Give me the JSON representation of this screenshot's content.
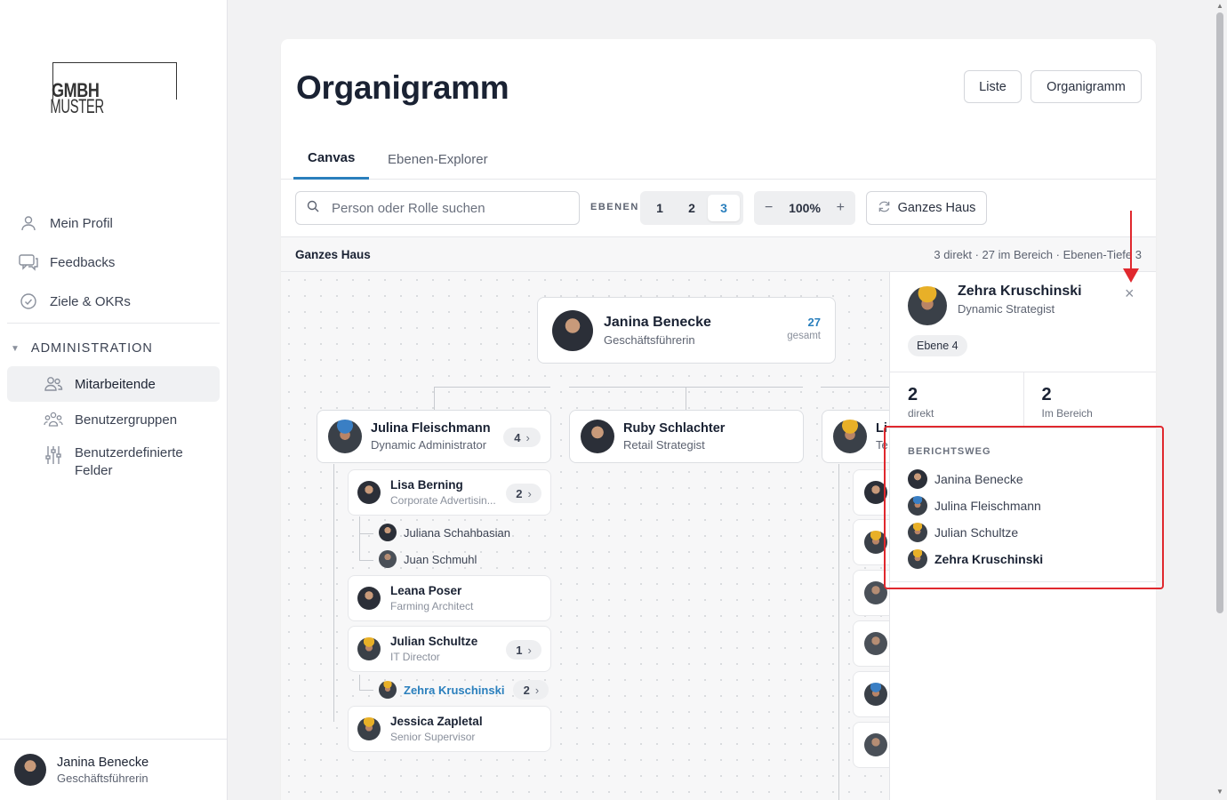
{
  "sidebar": {
    "logo": {
      "part1": "MUSTER",
      "part2": "GMBH"
    },
    "items": [
      {
        "label": "Mein Profil",
        "icon": "user-icon"
      },
      {
        "label": "Feedbacks",
        "icon": "chat-icon"
      },
      {
        "label": "Ziele & OKRs",
        "icon": "check-circle-icon"
      }
    ],
    "admin": {
      "heading": "ADMINISTRATION",
      "items": [
        {
          "label": "Mitarbeitende",
          "icon": "users-icon",
          "active": true
        },
        {
          "label": "Benutzergruppen",
          "icon": "group-icon"
        },
        {
          "label": "Benutzerdefinierte Felder",
          "icon": "sliders-icon"
        }
      ]
    },
    "footer": {
      "name": "Janina Benecke",
      "role": "Geschäftsführerin"
    }
  },
  "page": {
    "title": "Organigramm",
    "view_buttons": [
      "Liste",
      "Organigramm"
    ],
    "tabs": [
      "Canvas",
      "Ebenen-Explorer"
    ],
    "active_tab": "Canvas"
  },
  "toolbar": {
    "search_placeholder": "Person oder Rolle suchen",
    "levels_label": "EBENEN",
    "levels": [
      "1",
      "2",
      "3"
    ],
    "active_level": "3",
    "zoom": "100%",
    "zoom_out": "−",
    "zoom_in": "+",
    "house_button": "Ganzes Haus"
  },
  "subbar": {
    "scope": "Ganzes Haus",
    "summary": "3 direkt · 27 im Bereich · Ebenen-Tiefe 3"
  },
  "org": {
    "root": {
      "name": "Janina Benecke",
      "role": "Geschäftsführerin",
      "count": "27",
      "count_label": "gesamt"
    },
    "level2": [
      {
        "name": "Julina Fleischmann",
        "role": "Dynamic Administrator",
        "count": "4"
      },
      {
        "name": "Ruby Schlachter",
        "role": "Retail Strategist"
      },
      {
        "name": "Li",
        "role": "Te"
      }
    ],
    "level3": [
      {
        "name": "Lisa Berning",
        "role": "Corporate Advertisin...",
        "count": "2"
      },
      {
        "name": "Leana Poser",
        "role": "Farming Architect"
      },
      {
        "name": "Julian Schultze",
        "role": "IT Director",
        "count": "1"
      },
      {
        "name": "Jessica Zapletal",
        "role": "Senior Supervisor"
      }
    ],
    "leaves_lisa": [
      "Juliana Schahbasian",
      "Juan Schmuhl"
    ],
    "leaf_julian": {
      "name": "Zehra Kruschinski",
      "count": "2"
    }
  },
  "detail": {
    "name": "Zehra Kruschinski",
    "role": "Dynamic Strategist",
    "level": "Ebene 4",
    "direct_value": "2",
    "direct_label": "direkt",
    "area_value": "2",
    "area_label": "Im Bereich",
    "path_heading": "BERICHTSWEG",
    "path": [
      "Janina Benecke",
      "Julina Fleischmann",
      "Julian Schultze",
      "Zehra Kruschinski"
    ],
    "close": "×"
  },
  "colors": {
    "accent": "#2a7fbd",
    "annotation": "#e0282e"
  }
}
